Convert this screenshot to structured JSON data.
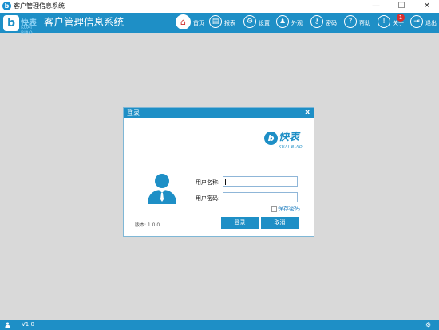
{
  "window": {
    "title": "客户管理信息系统",
    "controls": [
      "—",
      "☐",
      "✕"
    ]
  },
  "header": {
    "logo_text": "快表",
    "logo_sub": "KUAI BIAO",
    "app_title": "客户管理信息系统",
    "nav": [
      {
        "label": "首页",
        "icon": "home-icon",
        "glyph": "⌂",
        "active": true
      },
      {
        "label": "报表",
        "icon": "report-icon",
        "glyph": "▤"
      },
      {
        "label": "设置",
        "icon": "settings-icon",
        "glyph": "⚙"
      },
      {
        "label": "外观",
        "icon": "shirt-icon",
        "glyph": "♟"
      },
      {
        "label": "密码",
        "icon": "key-icon",
        "glyph": "⚷"
      },
      {
        "label": "帮助",
        "icon": "help-icon",
        "glyph": "?"
      },
      {
        "label": "关于",
        "icon": "info-icon",
        "glyph": "!",
        "badge": "1"
      },
      {
        "label": "退出",
        "icon": "exit-icon",
        "glyph": "⇥"
      }
    ]
  },
  "dialog": {
    "title": "登录",
    "close": "x",
    "brand_name": "快表",
    "brand_sub": "KUAI BIAO",
    "username_label": "用户名称:",
    "username_value": "",
    "password_label": "用户密码:",
    "password_value": "",
    "save_password_label": "保存密码",
    "save_password_checked": false,
    "version_text": "版本: 1.0.0",
    "login_button": "登录",
    "cancel_button": "取消"
  },
  "statusbar": {
    "version": "V1.0"
  },
  "colors": {
    "accent": "#1e8fc6",
    "badge": "#d83030",
    "workspace": "#d9d9d9"
  }
}
